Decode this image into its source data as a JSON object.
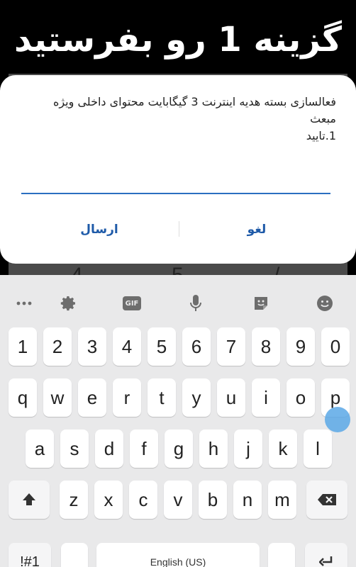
{
  "banner": {
    "text": "گزینه 1 رو بفرستید"
  },
  "background_keys": [
    "4",
    "5",
    "/"
  ],
  "dialog": {
    "message_line1": "فعالسازی بسته هدیه اینترنت 3 گیگابایت محتوای داخلی ویژه",
    "message_line2": "مبعث",
    "message_line3": "1.تایید",
    "input_value": "",
    "send_label": "ارسال",
    "cancel_label": "لغو"
  },
  "keyboard": {
    "toolbar": [
      "more-icon",
      "settings-gear-icon",
      "gif-icon",
      "microphone-icon",
      "sticker-icon",
      "emoji-icon"
    ],
    "gif_label": "GIF",
    "number_row": [
      "1",
      "2",
      "3",
      "4",
      "5",
      "6",
      "7",
      "8",
      "9",
      "0"
    ],
    "row1": [
      "q",
      "w",
      "e",
      "r",
      "t",
      "y",
      "u",
      "i",
      "o",
      "p"
    ],
    "row2": [
      "a",
      "s",
      "d",
      "f",
      "g",
      "h",
      "j",
      "k",
      "l"
    ],
    "row3": [
      "z",
      "x",
      "c",
      "v",
      "b",
      "n",
      "m"
    ],
    "symbols_label": "!#1",
    "space_label": "English (US)",
    "accent_color": "#1e5aa8",
    "underline_color": "#2a6fc0"
  }
}
